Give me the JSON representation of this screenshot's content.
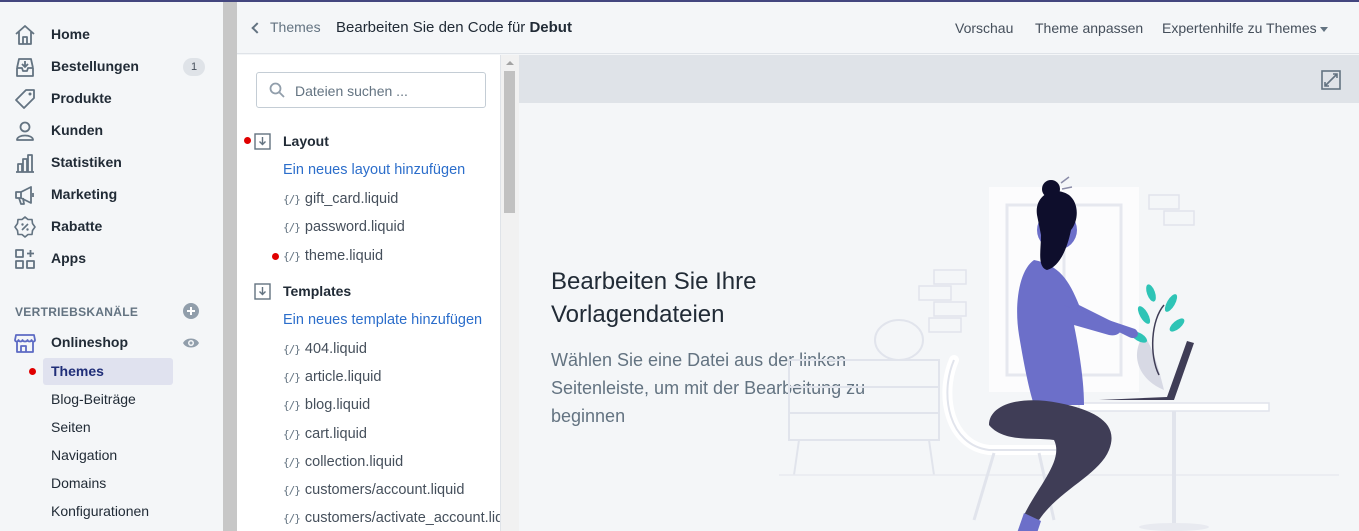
{
  "nav": {
    "items": [
      {
        "label": "Home",
        "icon": "home-icon"
      },
      {
        "label": "Bestellungen",
        "icon": "orders-icon",
        "badge": "1"
      },
      {
        "label": "Produkte",
        "icon": "tag-icon"
      },
      {
        "label": "Kunden",
        "icon": "person-icon"
      },
      {
        "label": "Statistiken",
        "icon": "bar-chart-icon"
      },
      {
        "label": "Marketing",
        "icon": "megaphone-icon"
      },
      {
        "label": "Rabatte",
        "icon": "discount-icon"
      },
      {
        "label": "Apps",
        "icon": "apps-icon"
      }
    ],
    "section_heading": "VERTRIEBSKANÄLE",
    "channel": "Onlineshop",
    "subitems": [
      "Themes",
      "Blog-Beiträge",
      "Seiten",
      "Navigation",
      "Domains",
      "Konfigurationen"
    ]
  },
  "topbar": {
    "back_label": "Themes",
    "title_prefix": "Bearbeiten Sie den Code für",
    "title_theme": "Debut",
    "links": [
      "Vorschau",
      "Theme anpassen",
      "Expertenhilfe zu Themes"
    ]
  },
  "files": {
    "search_placeholder": "Dateien suchen ...",
    "layout_folder": "Layout",
    "layout_add": "Ein neues layout hinzufügen",
    "layout_files": [
      "gift_card.liquid",
      "password.liquid",
      "theme.liquid"
    ],
    "templates_folder": "Templates",
    "templates_add": "Ein neues template hinzufügen",
    "template_files": [
      "404.liquid",
      "article.liquid",
      "blog.liquid",
      "cart.liquid",
      "collection.liquid",
      "customers/account.liquid",
      "customers/activate_account.liquid"
    ],
    "file_icon_text": "{/}"
  },
  "editor": {
    "empty_title": "Bearbeiten Sie Ihre Vorlagendateien",
    "empty_text": "Wählen Sie eine Datei aus der linken Seitenleiste, um mit der Bearbeitung zu beginnen"
  },
  "colors": {
    "accent": "#202e78",
    "link": "#2c6ecb",
    "illustration": "#6c6fc9",
    "marker": "#e00000"
  }
}
